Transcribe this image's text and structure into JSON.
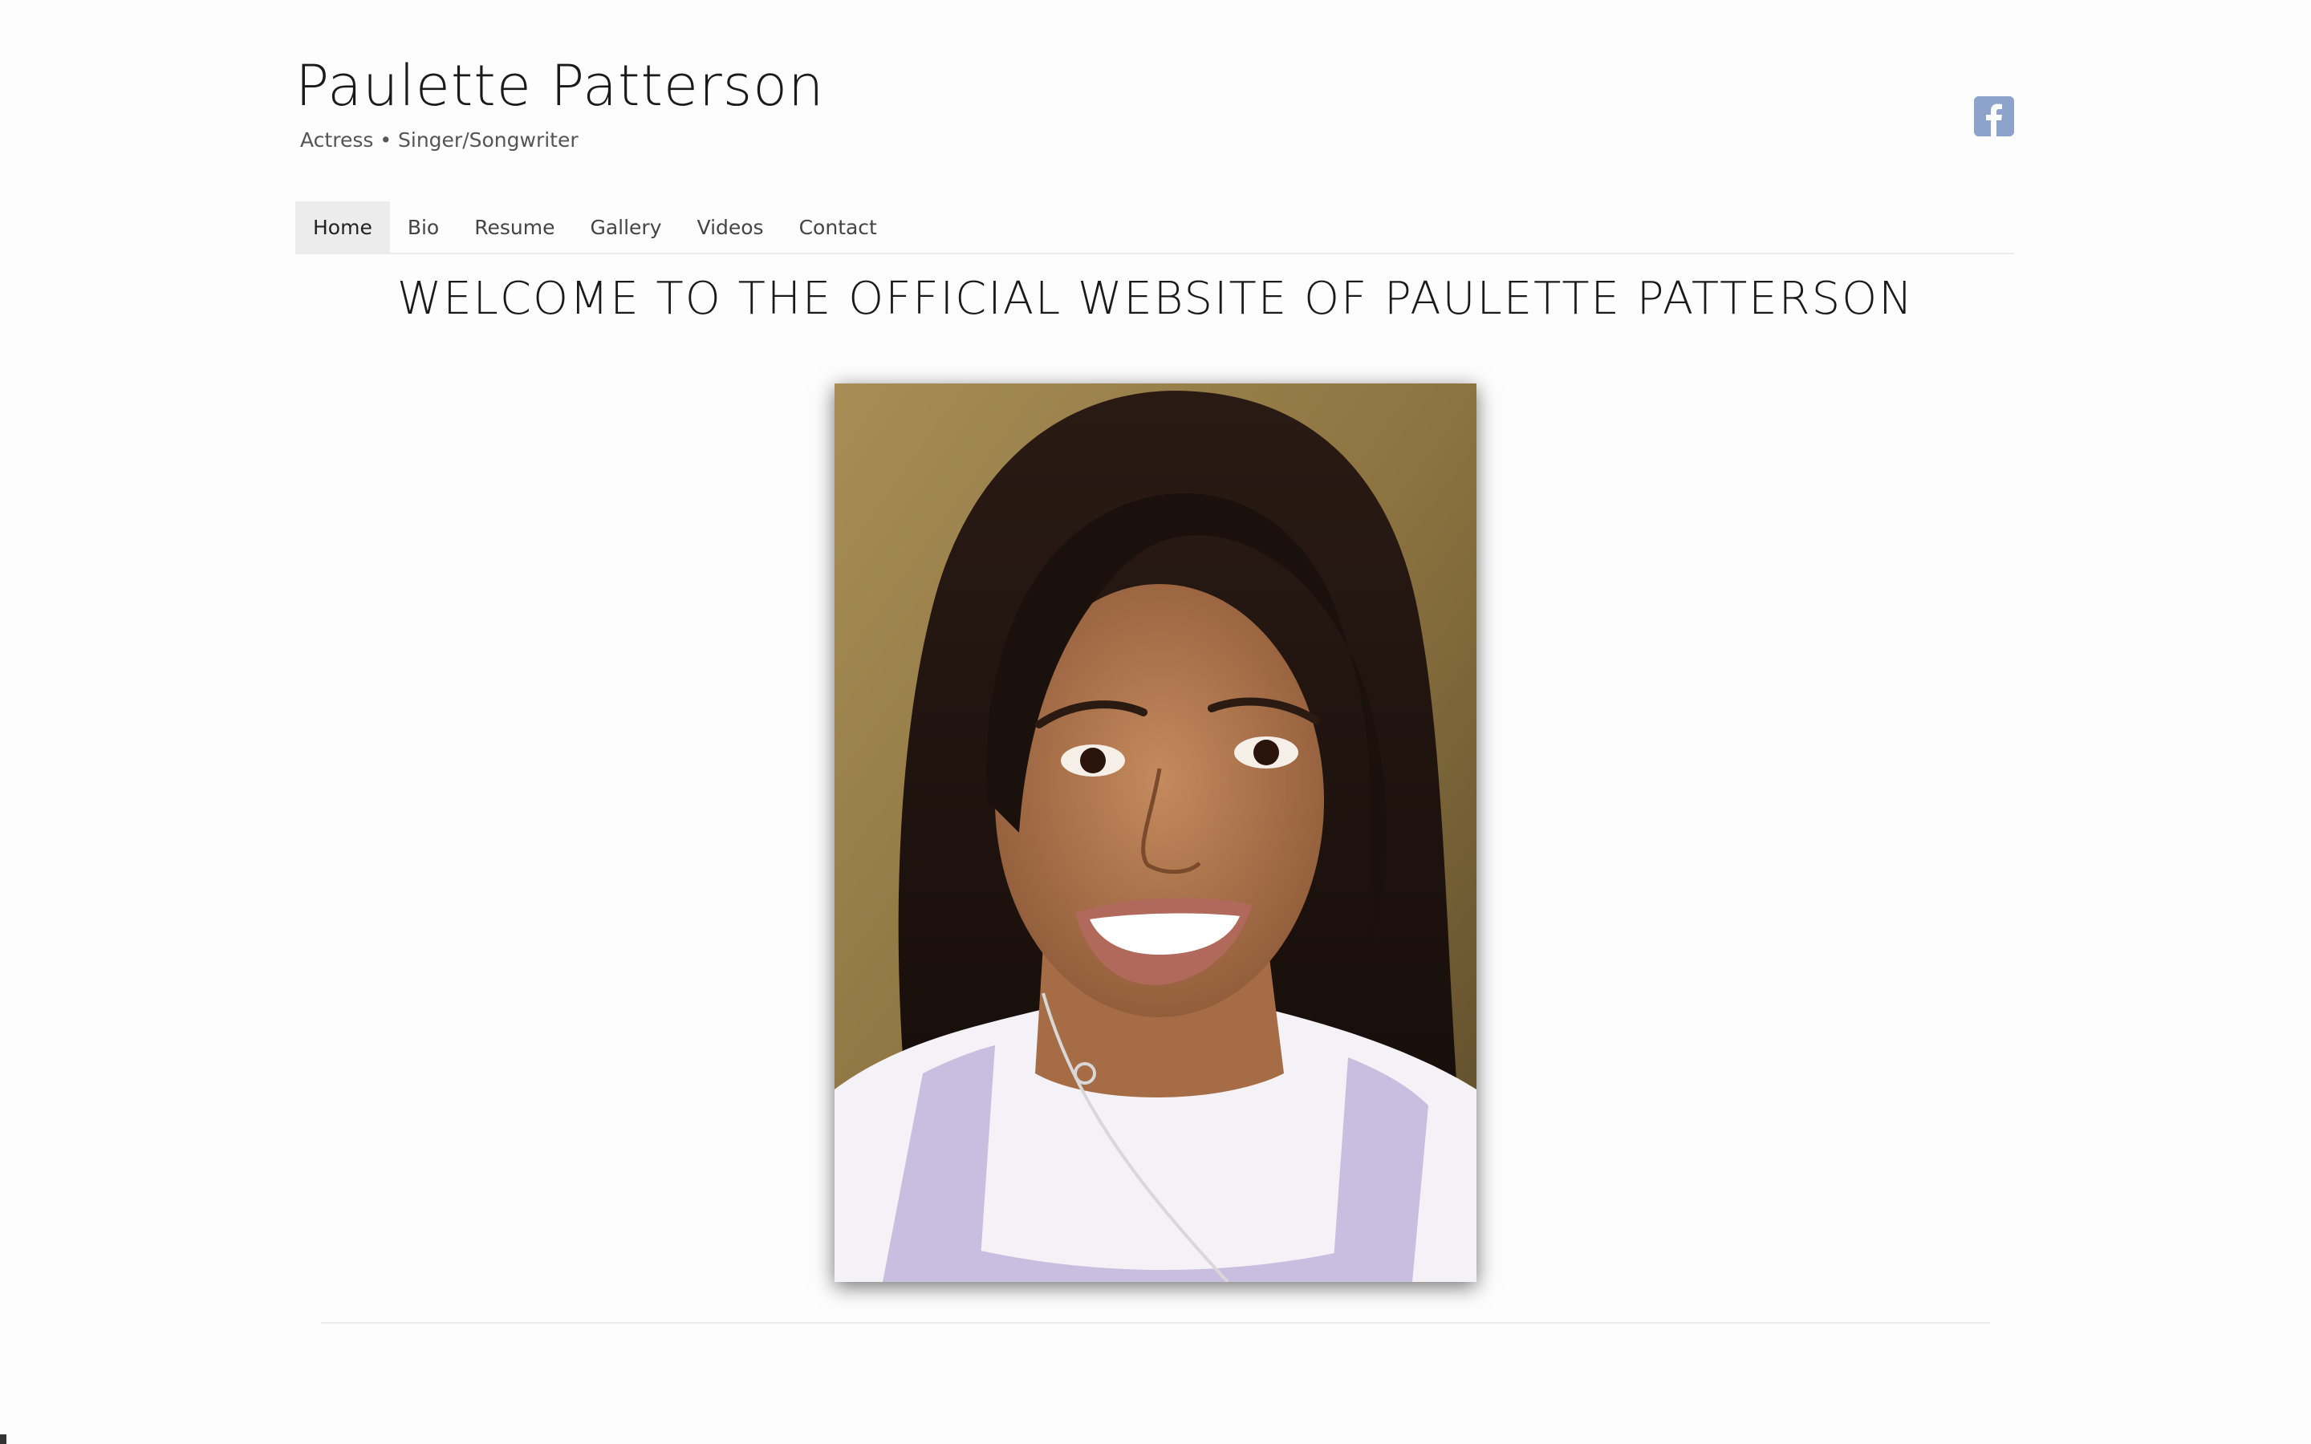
{
  "site": {
    "title": "Paulette Patterson",
    "tagline": "Actress • Singer/Songwriter"
  },
  "social": {
    "facebook_icon": "facebook-icon",
    "facebook_color": "#8ea3cc"
  },
  "nav": {
    "items": [
      {
        "label": "Home",
        "active": true
      },
      {
        "label": "Bio",
        "active": false
      },
      {
        "label": "Resume",
        "active": false
      },
      {
        "label": "Gallery",
        "active": false
      },
      {
        "label": "Videos",
        "active": false
      },
      {
        "label": "Contact",
        "active": false
      }
    ]
  },
  "main": {
    "heading": "WELCOME TO THE OFFICIAL WEBSITE OF PAULETTE PATTERSON"
  },
  "colors": {
    "background": "#fdfdfd",
    "active_tab": "#ececec",
    "text": "#222222"
  }
}
